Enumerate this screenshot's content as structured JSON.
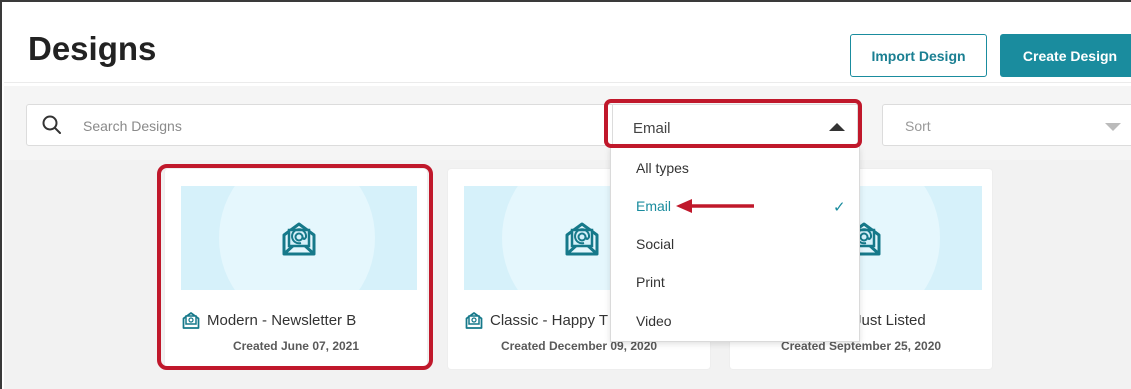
{
  "header": {
    "title": "Designs",
    "import_label": "Import Design",
    "create_label": "Create Design"
  },
  "filters": {
    "search_placeholder": "Search Designs",
    "type_selected": "Email",
    "sort_placeholder": "Sort"
  },
  "dropdown": {
    "items": [
      {
        "label": "All types",
        "selected": false
      },
      {
        "label": "Email",
        "selected": true
      },
      {
        "label": "Social",
        "selected": false
      },
      {
        "label": "Print",
        "selected": false
      },
      {
        "label": "Video",
        "selected": false
      }
    ],
    "check": "✓"
  },
  "cards": [
    {
      "name": "Modern - Newsletter B",
      "created": "Created June 07, 2021"
    },
    {
      "name": "Classic - Happy T",
      "created": "Created December 09, 2020"
    },
    {
      "name": "le - Just Listed",
      "created": "Created September 25, 2020"
    }
  ],
  "colors": {
    "accent": "#1a8c9e",
    "highlight": "#c0182b",
    "thumb_bg": "#d6f1fa",
    "icon": "#16798a"
  }
}
